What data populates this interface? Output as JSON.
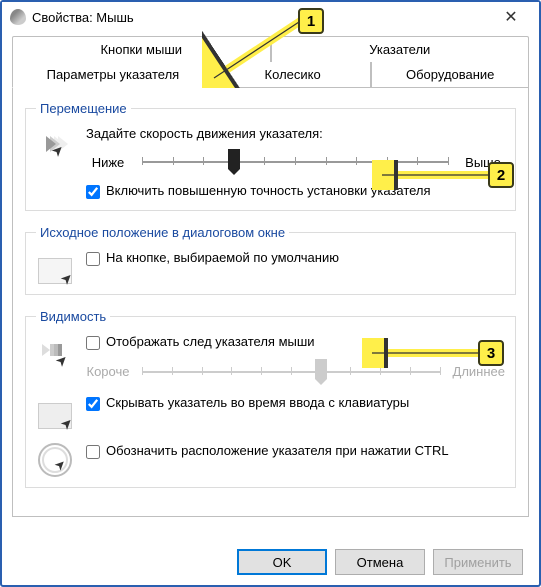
{
  "window": {
    "title": "Свойства: Мышь"
  },
  "tabs_row1": [
    {
      "label": "Кнопки мыши",
      "active": false
    },
    {
      "label": "Указатели",
      "active": false
    }
  ],
  "tabs_row2": [
    {
      "label": "Параметры указателя",
      "active": true
    },
    {
      "label": "Колесико",
      "active": false
    },
    {
      "label": "Оборудование",
      "active": false
    }
  ],
  "groups": {
    "motion": {
      "legend": "Перемещение",
      "speed_label": "Задайте скорость движения указателя:",
      "slower": "Ниже",
      "faster": "Выше",
      "speed_value": 3,
      "speed_max": 10,
      "enhance_checked": true,
      "enhance_label": "Включить повышенную точность установки указателя"
    },
    "snap": {
      "legend": "Исходное положение в диалоговом окне",
      "checked": false,
      "label": "На кнопке, выбираемой по умолчанию"
    },
    "visibility": {
      "legend": "Видимость",
      "trail_checked": false,
      "trail_label": "Отображать след указателя мыши",
      "trail_shorter": "Короче",
      "trail_longer": "Длиннее",
      "trail_value": 6,
      "trail_max": 10,
      "hide_checked": true,
      "hide_label": "Скрывать указатель во время ввода с клавиатуры",
      "locate_checked": false,
      "locate_label": "Обозначить расположение указателя при нажатии CTRL"
    }
  },
  "buttons": {
    "ok": "OK",
    "cancel": "Отмена",
    "apply": "Применить"
  },
  "annotations": {
    "n1": "1",
    "n2": "2",
    "n3": "3"
  }
}
